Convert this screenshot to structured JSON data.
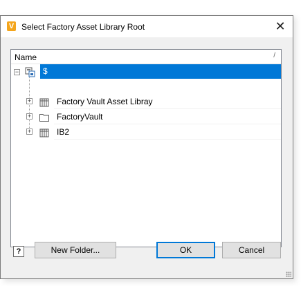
{
  "dialog": {
    "title": "Select Factory Asset Library Root",
    "app_icon_letter": "V",
    "close_glyph": "✕"
  },
  "tree": {
    "column_header": "Name",
    "column_sort_glyph": "/",
    "root": {
      "label": "$",
      "icon": "vault-root-icon",
      "expander": "−",
      "selected": true
    },
    "children": [
      {
        "label": "Factory Vault Asset Libray",
        "icon": "library-icon",
        "expander": "+"
      },
      {
        "label": "FactoryVault",
        "icon": "folder-icon",
        "expander": "+"
      },
      {
        "label": "IB2",
        "icon": "library-icon",
        "expander": "+"
      }
    ]
  },
  "buttons": {
    "help_label": "?",
    "new_folder": "New Folder...",
    "ok": "OK",
    "cancel": "Cancel"
  },
  "colors": {
    "selection": "#0078d7",
    "app_icon": "#f4a51c"
  }
}
